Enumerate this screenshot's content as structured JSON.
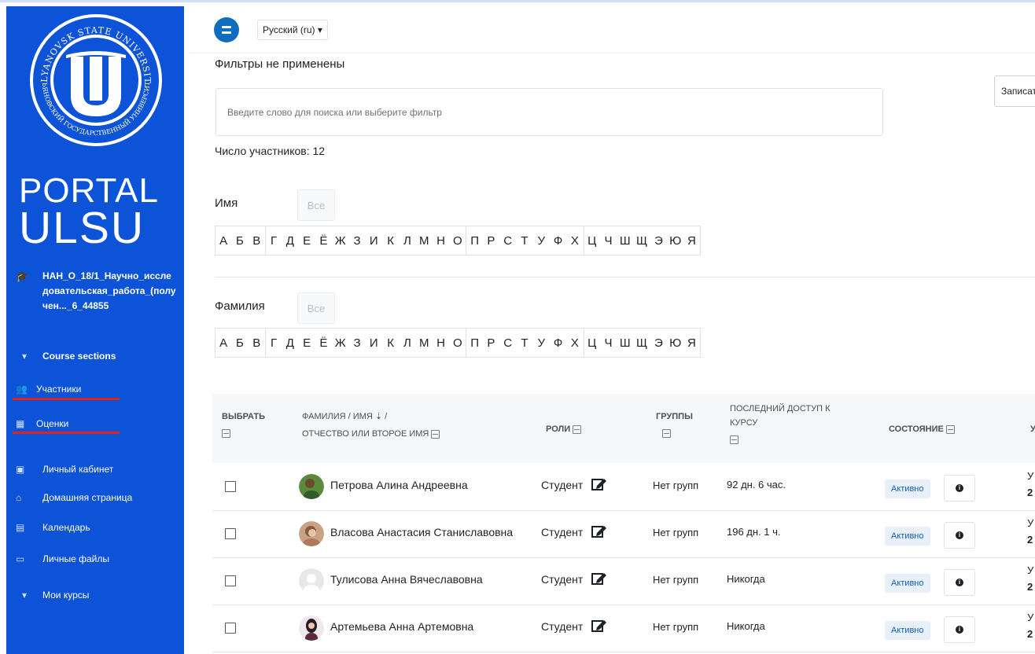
{
  "sidebar": {
    "logo": {
      "ring_text_top": "ULYANOVSK STATE UNIVERSITY",
      "ring_text_bottom": "УЛЬЯНОВСКИЙ ГОСУДАРСТВЕННЫЙ УНИВЕРСИТЕТ",
      "brand_line1": "PORTAL",
      "brand_line2": "ULSU"
    },
    "course_title": "НАН_О_18/1_Научно_исследовательская_работа_(получен..._6_44855",
    "items": [
      {
        "label": "Course sections",
        "icon": "chevron-down-icon"
      },
      {
        "label": "Участники",
        "icon": "users-icon"
      },
      {
        "label": "Оценки",
        "icon": "table-icon"
      },
      {
        "label": "Личный кабинет",
        "icon": "dashboard-icon"
      },
      {
        "label": "Домашняя страница",
        "icon": "home-icon"
      },
      {
        "label": "Календарь",
        "icon": "calendar-icon"
      },
      {
        "label": "Личные файлы",
        "icon": "folder-icon"
      },
      {
        "label": "Мои курсы",
        "icon": "chevron-down-icon"
      }
    ],
    "colors": {
      "background": "#0d53d8",
      "highlight": "#e0241c"
    }
  },
  "header": {
    "language": "Русский (ru) ▾"
  },
  "filters": {
    "title": "Фильтры не применены",
    "search_placeholder": "Введите слово для поиска или выберите фильтр",
    "enrol_button": "Записать"
  },
  "participants_count": "Число участников: 12",
  "initials": {
    "firstname_label": "Имя",
    "lastname_label": "Фамилия",
    "all_label": "Все",
    "letters": [
      "А",
      "Б",
      "В",
      "Г",
      "Д",
      "Е",
      "Ё",
      "Ж",
      "З",
      "И",
      "К",
      "Л",
      "М",
      "Н",
      "О",
      "П",
      "Р",
      "С",
      "Т",
      "У",
      "Ф",
      "Х",
      "Ц",
      "Ч",
      "Ш",
      "Щ",
      "Э",
      "Ю",
      "Я"
    ]
  },
  "table": {
    "headers": {
      "select": "ВЫБРАТЬ",
      "name_line1": "ФАМИЛИЯ / ИМЯ ⇣ /",
      "name_line2": "ОТЧЕСТВО ИЛИ ВТОРОЕ ИМЯ",
      "roles": "РОЛИ",
      "groups": "ГРУППЫ",
      "last_access_line1": "ПОСЛЕДНИЙ ДОСТУП К",
      "last_access_line2": "КУРСУ",
      "status": "СОСТОЯНИЕ",
      "clipped": "У"
    },
    "rows": [
      {
        "name": "Петрова Алина Андреевна",
        "role": "Студент",
        "groups": "Нет групп",
        "last_access": "92 дн. 6 час.",
        "status": "Активно",
        "clip1": "У",
        "clip2": "2"
      },
      {
        "name": "Власова Анастасия Станиславовна",
        "role": "Студент",
        "groups": "Нет групп",
        "last_access": "196 дн. 1 ч.",
        "status": "Активно",
        "clip1": "У",
        "clip2": "2"
      },
      {
        "name": "Тулисова Анна Вячеславовна",
        "role": "Студент",
        "groups": "Нет групп",
        "last_access": "Никогда",
        "status": "Активно",
        "clip1": "У",
        "clip2": "2"
      },
      {
        "name": "Артемьева Анна Артемовна",
        "role": "Студент",
        "groups": "Нет групп",
        "last_access": "Никогда",
        "status": "Активно",
        "clip1": "У",
        "clip2": "2"
      }
    ]
  }
}
